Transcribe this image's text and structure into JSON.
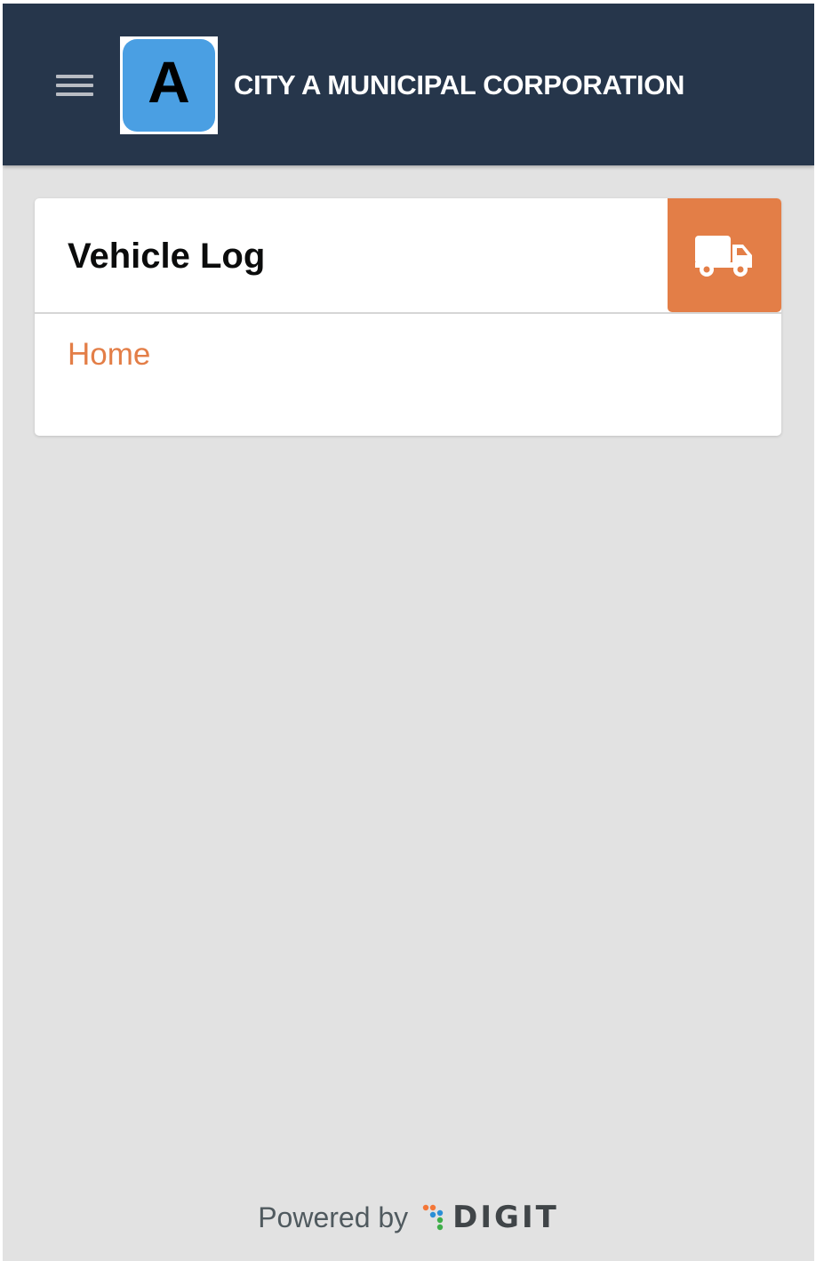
{
  "header": {
    "menu_icon": "hamburger-menu-icon",
    "logo_letter": "A",
    "corporation_name": "CITY A MUNICIPAL CORPORATION",
    "background_color": "#26364b"
  },
  "card": {
    "title": "Vehicle Log",
    "icon": "truck-icon",
    "icon_background": "#e37e47",
    "links": [
      {
        "label": "Home"
      }
    ]
  },
  "footer": {
    "powered_by": "Powered by",
    "brand": "DIGIT"
  }
}
